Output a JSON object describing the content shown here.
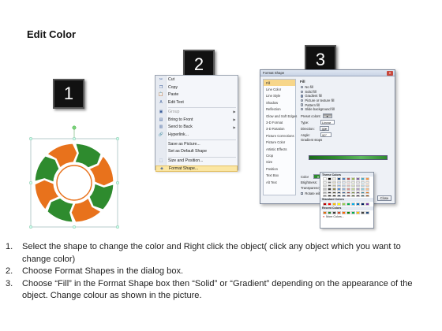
{
  "title": "Edit Color",
  "steps": [
    "1",
    "2",
    "3"
  ],
  "context_menu": {
    "items": [
      {
        "label": "Cut",
        "icon": "scissors-icon",
        "glyph": "✂",
        "disabled": false,
        "submenu": false
      },
      {
        "label": "Copy",
        "icon": "copy-icon",
        "glyph": "❐",
        "disabled": false,
        "submenu": false
      },
      {
        "label": "Paste",
        "icon": "paste-icon",
        "glyph": "📋",
        "disabled": false,
        "submenu": false
      },
      {
        "label": "Edit Text",
        "icon": "edit-text-icon",
        "glyph": "A",
        "disabled": false,
        "submenu": false
      },
      {
        "label": "Group",
        "icon": "group-icon",
        "glyph": "▣",
        "disabled": true,
        "submenu": true
      },
      {
        "label": "Bring to Front",
        "icon": "bring-front-icon",
        "glyph": "▤",
        "disabled": false,
        "submenu": true
      },
      {
        "label": "Send to Back",
        "icon": "send-back-icon",
        "glyph": "▥",
        "disabled": false,
        "submenu": true
      },
      {
        "label": "Hyperlink...",
        "icon": "hyperlink-icon",
        "glyph": "🔗",
        "disabled": false,
        "submenu": false
      },
      {
        "label": "Save as Picture...",
        "icon": "",
        "glyph": "",
        "disabled": false,
        "submenu": false
      },
      {
        "label": "Set as Default Shape",
        "icon": "",
        "glyph": "",
        "disabled": false,
        "submenu": false
      },
      {
        "label": "Size and Position...",
        "icon": "size-position-icon",
        "glyph": "⬚",
        "disabled": false,
        "submenu": false
      },
      {
        "label": "Format Shape...",
        "icon": "format-shape-icon",
        "glyph": "◈",
        "disabled": false,
        "submenu": false,
        "highlight": true
      }
    ]
  },
  "format_dialog": {
    "title": "Format Shape",
    "close_label": "Close",
    "nav": [
      "Fill",
      "Line Color",
      "Line Style",
      "Shadow",
      "Reflection",
      "Glow and Soft Edges",
      "3-D Format",
      "3-D Rotation",
      "Picture Corrections",
      "Picture Color",
      "Artistic Effects",
      "Crop",
      "Size",
      "Position",
      "Text Box",
      "Alt Text"
    ],
    "selected_nav": "Fill",
    "heading": "Fill",
    "fill_options": [
      {
        "label": "No fill",
        "on": false
      },
      {
        "label": "Solid fill",
        "on": false
      },
      {
        "label": "Gradient fill",
        "on": true
      },
      {
        "label": "Picture or texture fill",
        "on": false
      },
      {
        "label": "Pattern fill",
        "on": false
      },
      {
        "label": "Slide background fill",
        "on": false
      }
    ],
    "preset_label": "Preset colors:",
    "type_label": "Type:",
    "type_value": "Linear",
    "direction_label": "Direction:",
    "angle_label": "Angle:",
    "angle_value": "90°",
    "stops_label": "Gradient stops",
    "color_label": "Color",
    "position_label": "Position:",
    "position_value": "0%",
    "brightness_label": "Brightness:",
    "transparency_label": "Transparency:",
    "rotate_label": "Rotate with shape"
  },
  "color_palette": {
    "theme_label": "Theme Colors",
    "standard_label": "Standard Colors",
    "recent_label": "Recent Colors",
    "more_label": "More Colors...",
    "theme_top": [
      "#ffffff",
      "#000000",
      "#eeece1",
      "#1f497d",
      "#4f81bd",
      "#c0504d",
      "#9bbb59",
      "#8064a2",
      "#4bacc6",
      "#f79646"
    ],
    "theme_rows": [
      [
        "#f2f2f2",
        "#7f7f7f",
        "#ddd9c3",
        "#c6d9f0",
        "#dbe5f1",
        "#f2dcdb",
        "#ebf1dd",
        "#e5e0ec",
        "#dbeef3",
        "#fdeada"
      ],
      [
        "#d8d8d8",
        "#595959",
        "#c4bd97",
        "#8db3e2",
        "#b8cce4",
        "#e5b9b7",
        "#d7e3bc",
        "#ccc1d9",
        "#b7dde8",
        "#fbd5b5"
      ],
      [
        "#bfbfbf",
        "#3f3f3f",
        "#938953",
        "#548dd4",
        "#95b3d7",
        "#d99694",
        "#c3d69b",
        "#b2a2c7",
        "#92cddc",
        "#fac08f"
      ],
      [
        "#a5a5a5",
        "#262626",
        "#494429",
        "#17365d",
        "#366092",
        "#953734",
        "#76923c",
        "#5f497a",
        "#31859b",
        "#e36c09"
      ],
      [
        "#7f7f7f",
        "#0c0c0c",
        "#1d1b10",
        "#0f243e",
        "#244061",
        "#632423",
        "#4f6128",
        "#3f3151",
        "#205867",
        "#974806"
      ]
    ],
    "standard": [
      "#c00000",
      "#ff0000",
      "#ffc000",
      "#ffff00",
      "#92d050",
      "#00b050",
      "#00b0f0",
      "#0070c0",
      "#002060",
      "#7030a0"
    ],
    "recent": [
      "#e46c0a",
      "#1d8a2b",
      "#3a3a3a",
      "#d24726",
      "#ff6600",
      "#008000",
      "#00b050",
      "#ffc000",
      "#404040",
      "#1f497d"
    ]
  },
  "instructions": [
    {
      "num": "1.",
      "text": "Select the shape to change the color and Right click the object( click any object which you want to change color)"
    },
    {
      "num": "2.",
      "text": "Choose Format Shapes in the dialog box."
    },
    {
      "num": "3.",
      "text": "Choose “Fill” in the Format Shape box then “Solid” or “Gradient” depending on the appearance of the object. Change colour as shown in the picture."
    }
  ],
  "colors": {
    "orange": "#e8721c",
    "green": "#2e8b2e",
    "badge_bg": "#111111",
    "highlight": "#fbe6a2"
  }
}
